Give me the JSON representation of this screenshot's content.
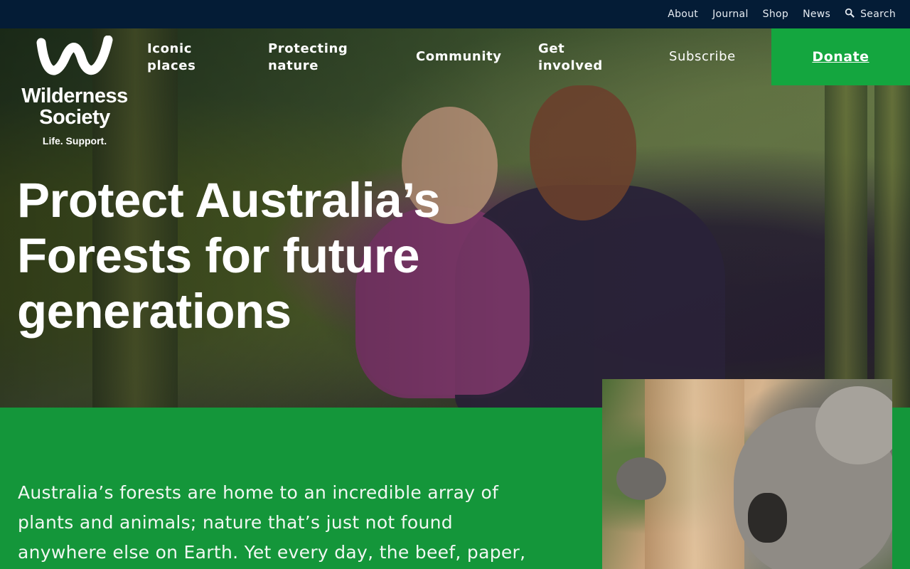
{
  "topbar": {
    "links": [
      "About",
      "Journal",
      "Shop",
      "News"
    ],
    "search_label": "Search"
  },
  "logo": {
    "name_line1": "Wilderness",
    "name_line2": "Society",
    "tagline": "Life. Support."
  },
  "nav": {
    "iconic_l1": "Iconic",
    "iconic_l2": "places",
    "protecting_l1": "Protecting",
    "protecting_l2": "nature",
    "community": "Community",
    "involved_l1": "Get",
    "involved_l2": "involved",
    "subscribe": "Subscribe",
    "donate": "Donate"
  },
  "hero": {
    "headline_l1": "Protect Australia’s",
    "headline_l2": "Forests for future",
    "headline_l3": "generations"
  },
  "intro": {
    "text": "Australia’s forests are home to an incredible array of plants and animals; nature that’s just not found anywhere else on Earth. Yet every day, the beef, paper,"
  },
  "colors": {
    "topbar_bg": "#041c36",
    "green": "#14963a",
    "donate_bg": "#14a63f"
  }
}
